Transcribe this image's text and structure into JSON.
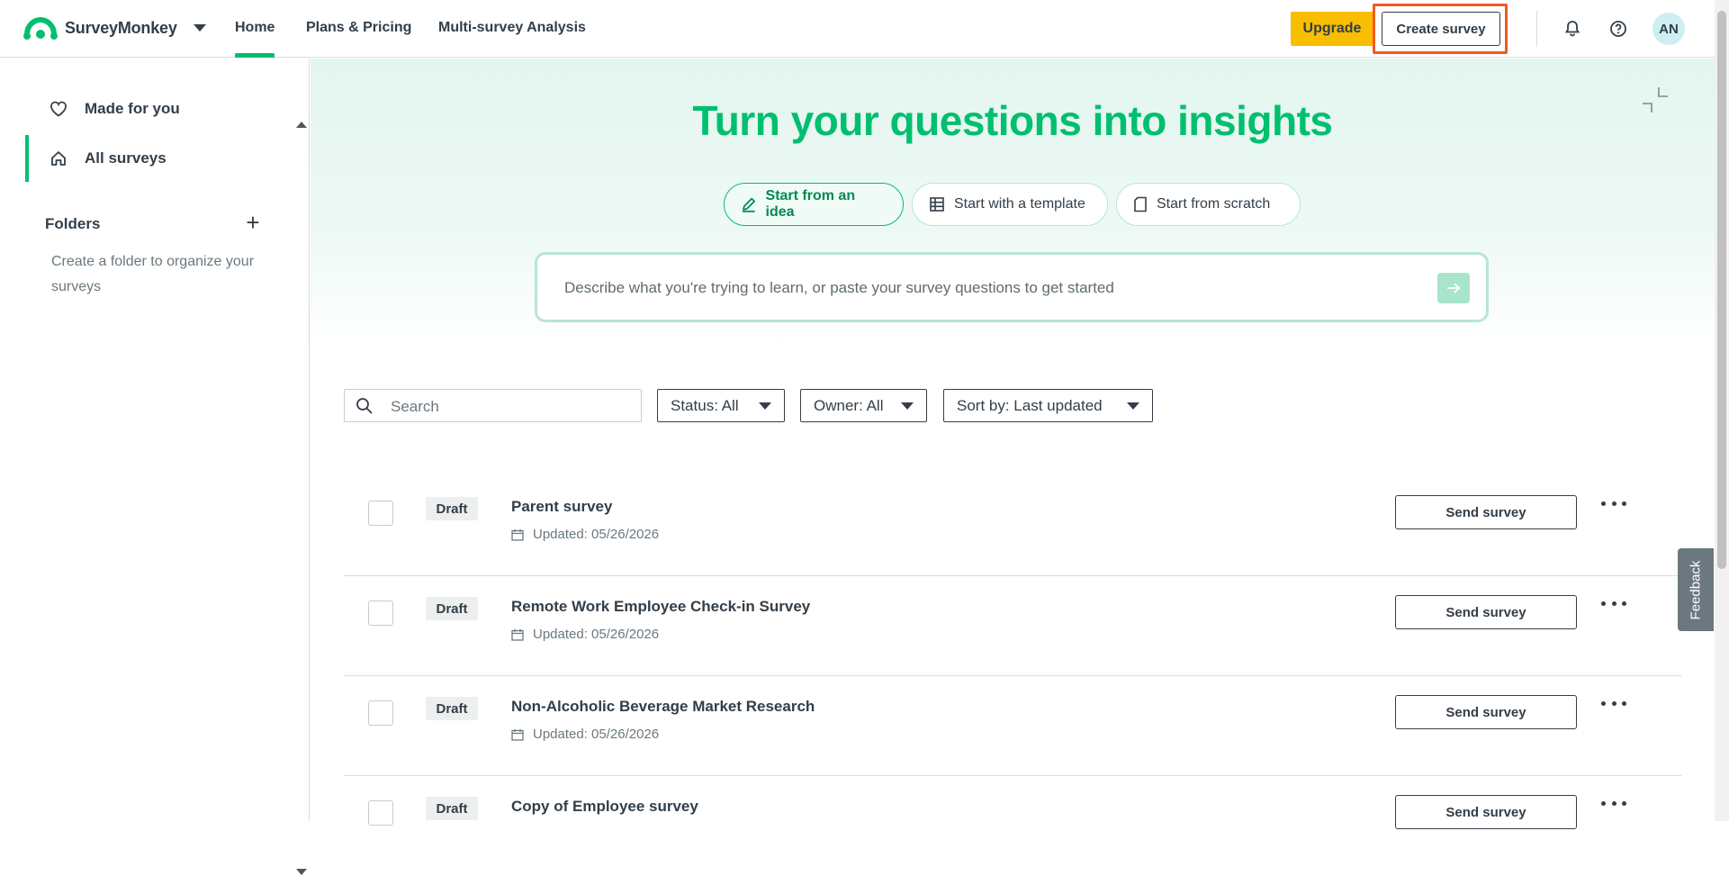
{
  "topnav": {
    "brand": "SurveyMonkey",
    "links": [
      "Home",
      "Plans & Pricing",
      "Multi-survey Analysis"
    ],
    "active_link": "Home",
    "upgrade_label": "Upgrade",
    "create_label": "Create survey",
    "avatar_initials": "AN"
  },
  "sidebar": {
    "items": [
      {
        "label": "Made for you",
        "icon": "heart-icon"
      },
      {
        "label": "All surveys",
        "icon": "home-icon"
      }
    ],
    "folders_title": "Folders",
    "folders_hint": "Create a folder to organize your surveys"
  },
  "hero": {
    "title": "Turn your questions into insights",
    "options": [
      {
        "label": "Start from an idea",
        "icon": "pencil-icon",
        "active": true
      },
      {
        "label": "Start with a template",
        "icon": "template-grid-icon",
        "active": false
      },
      {
        "label": "Start from scratch",
        "icon": "blank-page-icon",
        "active": false
      }
    ],
    "prompt_placeholder": "Describe what you're trying to learn, or paste your survey questions to get started"
  },
  "filters": {
    "search_placeholder": "Search",
    "status": "Status: All",
    "owner": "Owner: All",
    "sort": "Sort by: Last updated"
  },
  "surveys": [
    {
      "status": "Draft",
      "title": "Parent survey",
      "updated": "Updated: 05/26/2026",
      "action": "Send survey"
    },
    {
      "status": "Draft",
      "title": "Remote Work Employee Check-in Survey",
      "updated": "Updated: 05/26/2026",
      "action": "Send survey"
    },
    {
      "status": "Draft",
      "title": "Non-Alcoholic Beverage Market Research",
      "updated": "Updated: 05/26/2026",
      "action": "Send survey"
    },
    {
      "status": "Draft",
      "title": "Copy of Employee survey",
      "updated": "",
      "action": "Send survey"
    }
  ],
  "feedback_label": "Feedback",
  "colors": {
    "brand_green": "#00bf6f",
    "upgrade_yellow": "#f9be00",
    "highlight_orange": "#f05a22",
    "text_dark": "#333e48"
  }
}
